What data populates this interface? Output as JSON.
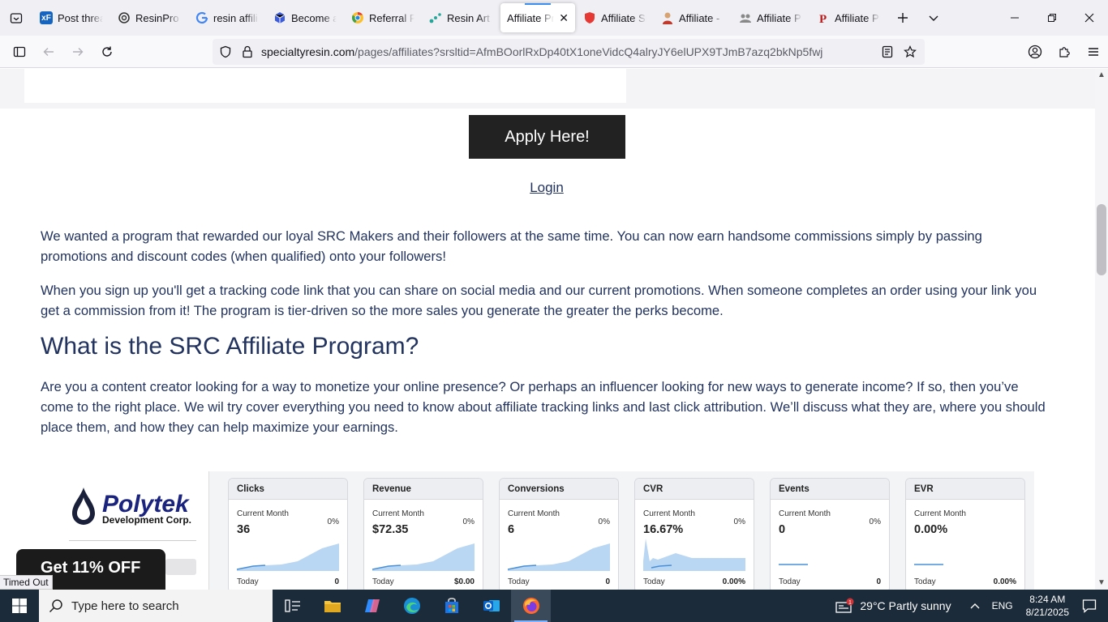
{
  "browser": {
    "tabs": [
      {
        "label": "Post threa",
        "favicon": "xf",
        "color": "#1565c0"
      },
      {
        "label": "ResinPro a",
        "favicon": "openai",
        "color": "#333333"
      },
      {
        "label": "resin affili",
        "favicon": "google",
        "color": "#4285f4"
      },
      {
        "label": "Become a",
        "favicon": "cube",
        "color": "#3b5bdb"
      },
      {
        "label": "Referral P",
        "favicon": "chrome",
        "color": "#e53935"
      },
      {
        "label": "Resin Art",
        "favicon": "dots",
        "color": "#26a69a"
      },
      {
        "label": "Affiliate Pr",
        "favicon": "none",
        "color": "#ffffff",
        "active": true
      },
      {
        "label": "Affiliate Si",
        "favicon": "shield",
        "color": "#e53935"
      },
      {
        "label": "Affiliate -",
        "favicon": "avatar",
        "color": "#c0392b"
      },
      {
        "label": "Affiliate P",
        "favicon": "people",
        "color": "#888888"
      },
      {
        "label": "Affiliate Pr",
        "favicon": "p",
        "color": "#b71c1c"
      }
    ],
    "url_domain": "specialtyresin.com",
    "url_path": "/pages/affiliates?srsltid=AfmBOorlRxDp40tX1oneVidcQ4alryJY6elUPX9TJmB7azq2bkNp5fwj"
  },
  "page": {
    "apply_button": "Apply Here!",
    "login_link": "Login",
    "para1": "We wanted a program that rewarded our loyal SRC Makers and their followers at the same time. You can now earn handsome commissions simply by passing promotions and discount codes (when qualified) onto your followers!",
    "para2": "When you sign up you'll get a tracking code link that you can share on social media and our current promotions. When someone completes an order using your link you get a commission from it! The program is tier-driven so the more sales you generate the greater the perks become.",
    "heading": "What is the SRC Affiliate Program?",
    "para3": "Are you a content creator looking for a way to monetize your online presence? Or perhaps an influencer looking for new ways to generate income? If so, then you’ve come to the right place. We wil try cover everything you need to know about affiliate tracking links and last click attribution. We’ll discuss what they are, where you should place them, and how they can help maximize your earnings.",
    "logo_name": "Polytek",
    "logo_sub": "Development Corp.",
    "promo": "Get 11% OFF",
    "status": "Timed Out"
  },
  "dashboard": {
    "sub_label": "Current Month",
    "today_label": "Today",
    "cards": [
      {
        "title": "Clicks",
        "value": "36",
        "pct": "0%",
        "today": "0",
        "shape": "rise"
      },
      {
        "title": "Revenue",
        "value": "$72.35",
        "pct": "0%",
        "today": "$0.00",
        "shape": "rise"
      },
      {
        "title": "Conversions",
        "value": "6",
        "pct": "0%",
        "today": "0",
        "shape": "rise"
      },
      {
        "title": "CVR",
        "value": "16.67%",
        "pct": "0%",
        "today": "0.00%",
        "shape": "spike"
      },
      {
        "title": "Events",
        "value": "0",
        "pct": "0%",
        "today": "0",
        "shape": "flat"
      },
      {
        "title": "EVR",
        "value": "0.00%",
        "pct": "",
        "today": "0.00%",
        "shape": "flat"
      }
    ],
    "accent": "#4a90d9",
    "fill": "#b9d6f2"
  },
  "taskbar": {
    "search_placeholder": "Type here to search",
    "weather": "29°C  Partly sunny",
    "lang": "ENG",
    "time": "8:24 AM",
    "date": "8/21/2025",
    "notification_count": "1"
  }
}
